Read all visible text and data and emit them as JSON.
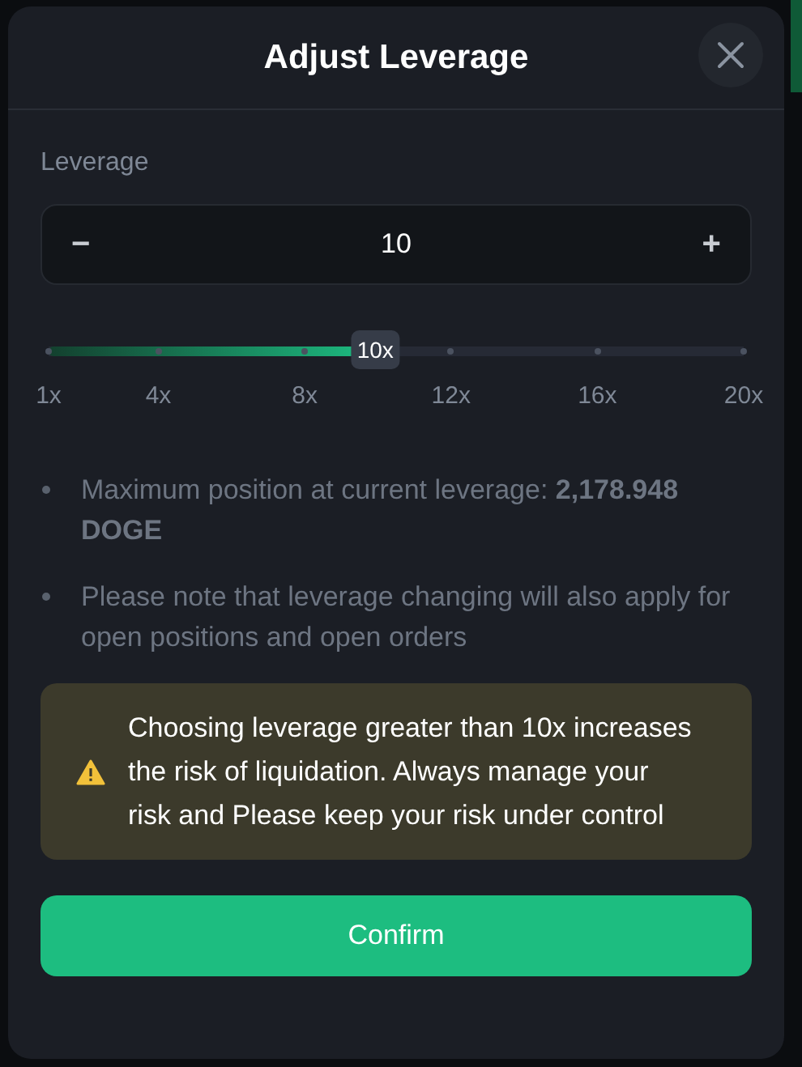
{
  "dialog": {
    "title": "Adjust Leverage"
  },
  "leverage": {
    "label": "Leverage",
    "value": "10",
    "decrement": "−",
    "increment": "+"
  },
  "slider": {
    "level": 0.47,
    "thumb_label": "10x",
    "ticks": [
      "1x",
      "4x",
      "8x",
      "12x",
      "16x",
      "20x"
    ]
  },
  "notes": [
    "Maximum position at current leverage: **2,178.948 DOGE**",
    "Please note that leverage changing will also apply for open positions and open orders"
  ],
  "warning": {
    "text": "Choosing leverage greater than 10x increases the risk of liquidation. Always manage your risk and Please keep your risk under control"
  },
  "confirm": "Confirm"
}
